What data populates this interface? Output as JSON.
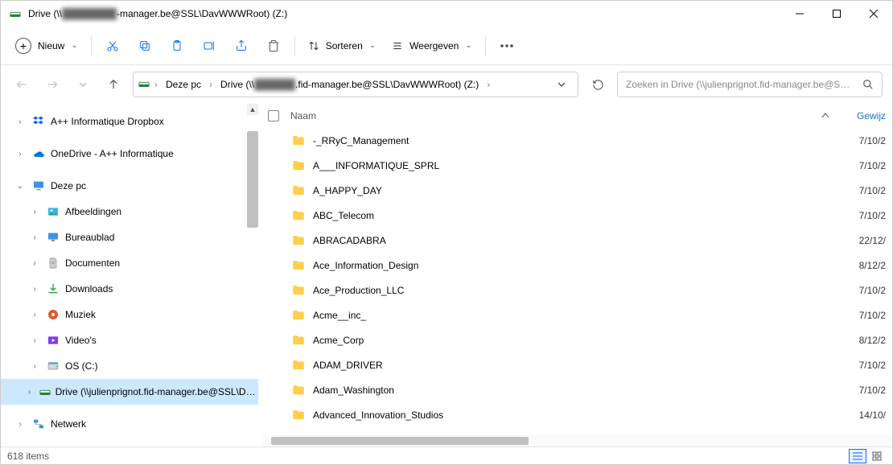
{
  "window": {
    "title_prefix": "Drive (\\\\",
    "title_blur": "████████",
    "title_suffix": "-manager.be@SSL\\DavWWWRoot) (Z:)"
  },
  "toolbar": {
    "new_label": "Nieuw",
    "sort_label": "Sorteren",
    "view_label": "Weergeven"
  },
  "nav": {
    "crumb1": "Deze pc",
    "crumb2_prefix": "Drive (\\\\",
    "crumb2_blur": "██████",
    "crumb2_suffix": ".fid-manager.be@SSL\\DavWWWRoot) (Z:)",
    "search_placeholder": "Zoeken in Drive (\\\\julienprignot.fid-manager.be@SSL..."
  },
  "tree": [
    {
      "label": "A++ Informatique Dropbox",
      "icon": "dropbox",
      "level": 0,
      "chev": "right"
    },
    {
      "label": "",
      "icon": "none",
      "level": 0,
      "chev": "none",
      "spacer": true
    },
    {
      "label": "OneDrive - A++ Informatique",
      "icon": "onedrive",
      "level": 0,
      "chev": "right"
    },
    {
      "label": "",
      "icon": "none",
      "level": 0,
      "chev": "none",
      "spacer": true
    },
    {
      "label": "Deze pc",
      "icon": "pc",
      "level": 0,
      "chev": "down"
    },
    {
      "label": "Afbeeldingen",
      "icon": "pictures",
      "level": 1,
      "chev": "right"
    },
    {
      "label": "Bureaublad",
      "icon": "desktop",
      "level": 1,
      "chev": "right"
    },
    {
      "label": "Documenten",
      "icon": "documents",
      "level": 1,
      "chev": "right"
    },
    {
      "label": "Downloads",
      "icon": "downloads",
      "level": 1,
      "chev": "right"
    },
    {
      "label": "Muziek",
      "icon": "music",
      "level": 1,
      "chev": "right"
    },
    {
      "label": "Video's",
      "icon": "videos",
      "level": 1,
      "chev": "right"
    },
    {
      "label": "OS (C:)",
      "icon": "disk",
      "level": 1,
      "chev": "right"
    },
    {
      "label": "Drive (\\\\julienprignot.fid-manager.be@SSL\\DavWWWRoot) (Z:)",
      "icon": "netdrive",
      "level": 1,
      "chev": "right",
      "selected": true
    },
    {
      "label": "",
      "icon": "none",
      "level": 0,
      "chev": "none",
      "spacer": true
    },
    {
      "label": "Netwerk",
      "icon": "network",
      "level": 0,
      "chev": "right"
    }
  ],
  "columns": {
    "name": "Naam",
    "date": "Gewijz"
  },
  "rows": [
    {
      "name": "-_RRyC_Management",
      "date": "7/10/2"
    },
    {
      "name": "A___INFORMATIQUE_SPRL",
      "date": "7/10/2"
    },
    {
      "name": "A_HAPPY_DAY",
      "date": "7/10/2"
    },
    {
      "name": "ABC_Telecom",
      "date": "7/10/2"
    },
    {
      "name": "ABRACADABRA",
      "date": "22/12/"
    },
    {
      "name": "Ace_Information_Design",
      "date": "8/12/2"
    },
    {
      "name": "Ace_Production_LLC",
      "date": "7/10/2"
    },
    {
      "name": "Acme__inc_",
      "date": "7/10/2"
    },
    {
      "name": "Acme_Corp",
      "date": "8/12/2"
    },
    {
      "name": "ADAM_DRIVER",
      "date": "7/10/2"
    },
    {
      "name": "Adam_Washington",
      "date": "7/10/2"
    },
    {
      "name": "Advanced_Innovation_Studios",
      "date": "14/10/"
    }
  ],
  "status": {
    "count": "618 items"
  },
  "icons": {
    "dropbox": "dropbox-icon",
    "onedrive": "onedrive-icon",
    "pc": "pc-icon",
    "pictures": "pictures-icon",
    "desktop": "desktop-icon",
    "documents": "documents-icon",
    "downloads": "downloads-icon",
    "music": "music-icon",
    "videos": "videos-icon",
    "disk": "disk-icon",
    "netdrive": "netdrive-icon",
    "network": "network-icon"
  }
}
